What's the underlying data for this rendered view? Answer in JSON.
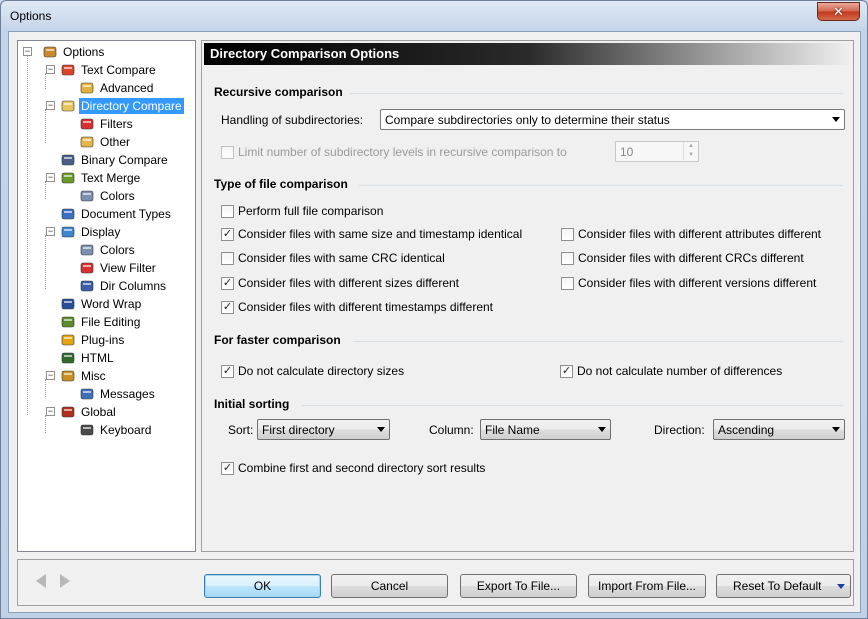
{
  "window": {
    "title": "Options",
    "close": "✕"
  },
  "tree": [
    {
      "label": "Options",
      "icon": "options-icon"
    },
    {
      "label": "Text Compare",
      "icon": "text-compare-icon"
    },
    {
      "label": "Advanced",
      "icon": "wand-icon"
    },
    {
      "label": "Directory Compare",
      "icon": "folder-compare-icon",
      "selected": true
    },
    {
      "label": "Filters",
      "icon": "filter-icon"
    },
    {
      "label": "Other",
      "icon": "folder-other-icon"
    },
    {
      "label": "Binary Compare",
      "icon": "binary-icon"
    },
    {
      "label": "Text Merge",
      "icon": "merge-icon"
    },
    {
      "label": "Colors",
      "icon": "colors-icon"
    },
    {
      "label": "Document Types",
      "icon": "document-types-icon"
    },
    {
      "label": "Display",
      "icon": "display-icon"
    },
    {
      "label": "Colors",
      "icon": "colors-icon"
    },
    {
      "label": "View Filter",
      "icon": "filter-icon"
    },
    {
      "label": "Dir Columns",
      "icon": "columns-icon"
    },
    {
      "label": "Word Wrap",
      "icon": "word-wrap-icon"
    },
    {
      "label": "File Editing",
      "icon": "file-editing-icon"
    },
    {
      "label": "Plug-ins",
      "icon": "plugin-icon"
    },
    {
      "label": "HTML",
      "icon": "html-icon"
    },
    {
      "label": "Misc",
      "icon": "misc-icon"
    },
    {
      "label": "Messages",
      "icon": "messages-icon"
    },
    {
      "label": "Global",
      "icon": "global-icon"
    },
    {
      "label": "Keyboard",
      "icon": "keyboard-icon"
    }
  ],
  "panel": {
    "header": "Directory Comparison Options",
    "recursive": {
      "title": "Recursive comparison",
      "handling_label": "Handling of subdirectories:",
      "handling_value": "Compare subdirectories only to determine their status",
      "limit_label": "Limit number of subdirectory levels in recursive comparison to",
      "limit_value": "10"
    },
    "type": {
      "title": "Type of file comparison",
      "full": "Perform full file comparison",
      "left": [
        {
          "label": "Consider files with same size and timestamp identical",
          "checked": true
        },
        {
          "label": "Consider files with same CRC identical",
          "checked": false
        },
        {
          "label": "Consider files with different sizes different",
          "checked": true
        },
        {
          "label": "Consider files with different timestamps different",
          "checked": true
        }
      ],
      "right": [
        {
          "label": "Consider files with different attributes different",
          "checked": false
        },
        {
          "label": "Consider files with different CRCs different",
          "checked": false
        },
        {
          "label": "Consider files with different versions different",
          "checked": false
        }
      ]
    },
    "faster": {
      "title": "For faster comparison",
      "dir_sizes": "Do not calculate directory sizes",
      "num_diffs": "Do not calculate number of differences"
    },
    "sorting": {
      "title": "Initial sorting",
      "sort_label": "Sort:",
      "sort_value": "First directory",
      "column_label": "Column:",
      "column_value": "File Name",
      "direction_label": "Direction:",
      "direction_value": "Ascending",
      "combine": "Combine first and second directory sort results"
    }
  },
  "buttons": {
    "ok": "OK",
    "cancel": "Cancel",
    "export": "Export To File...",
    "import": "Import From File...",
    "reset": "Reset To Default"
  },
  "check_mark": "✓"
}
